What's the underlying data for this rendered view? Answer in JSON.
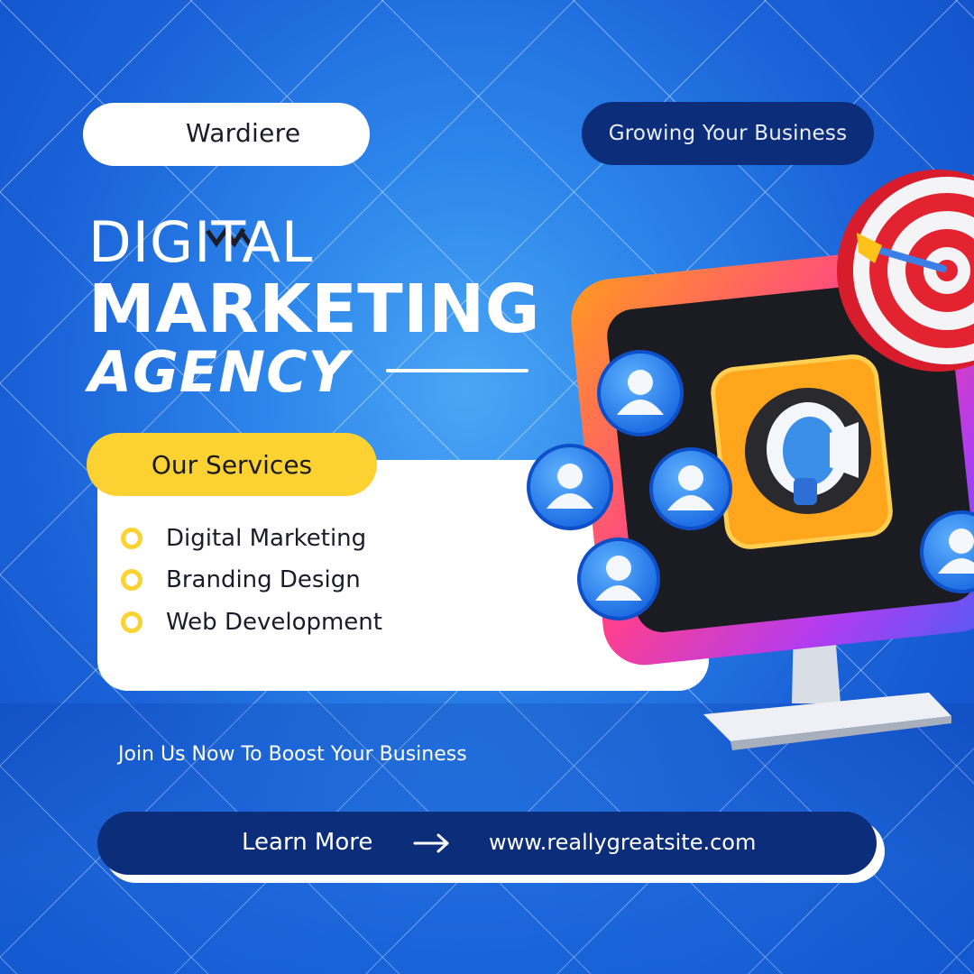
{
  "brand": {
    "name": "Wardiere",
    "logo_icon": "w-zigzag-icon"
  },
  "tagline": "Growing Your Business",
  "headline": {
    "line1": "DIGITAL",
    "line2": "MARKETING",
    "line3": "AGENCY"
  },
  "services": {
    "heading": "Our Services",
    "items": [
      {
        "label": "Digital Marketing"
      },
      {
        "label": "Branding Design"
      },
      {
        "label": "Web Development"
      }
    ]
  },
  "join_text": "Join Us Now To Boost Your Business",
  "cta": {
    "label": "Learn More",
    "url": "www.reallygreatsite.com",
    "arrow_icon": "arrow-right-icon"
  },
  "colors": {
    "background": "#1a62d8",
    "navy": "#0c2d7a",
    "yellow": "#fcd232",
    "white": "#ffffff"
  },
  "illustration": {
    "icons": [
      "monitor-icon",
      "megaphone-icon",
      "target-icon",
      "user-avatar-icon"
    ]
  }
}
